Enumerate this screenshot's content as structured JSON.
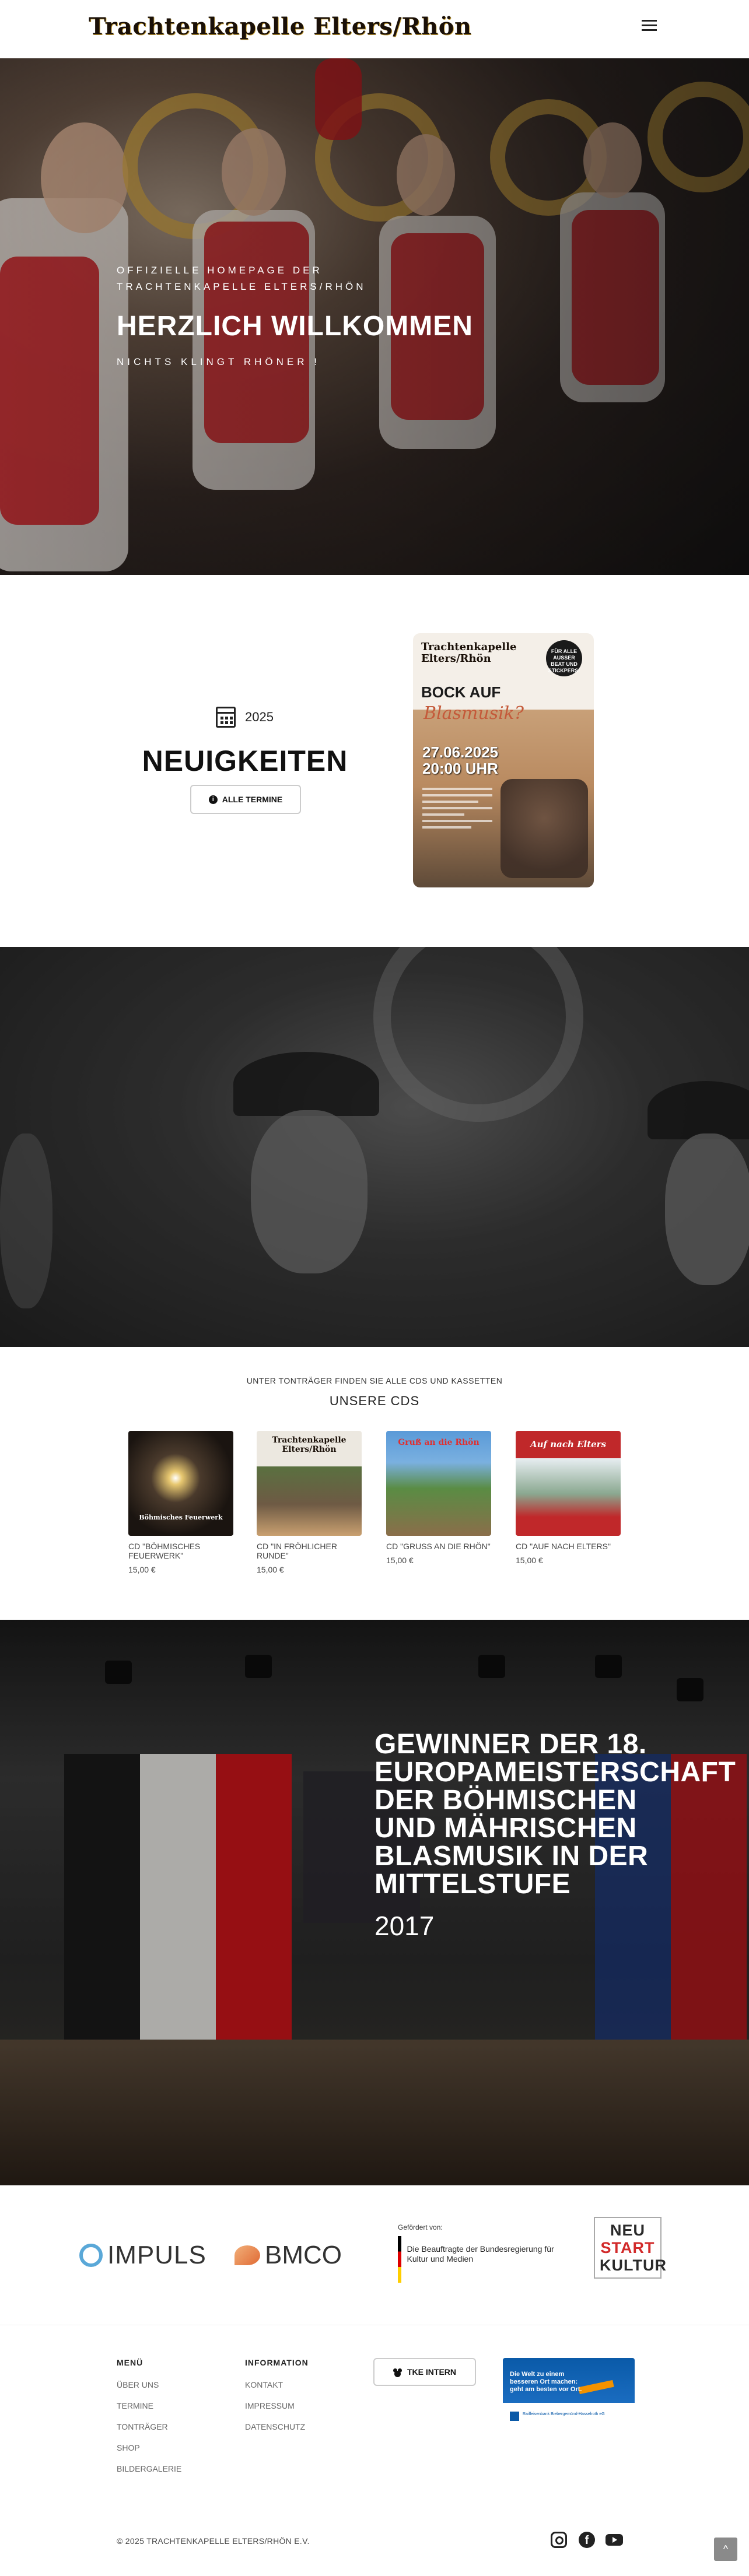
{
  "header": {
    "logo_text": "Trachtenkapelle Elters/Rhön",
    "menu_icon": "hamburger-icon"
  },
  "hero": {
    "kicker_line1": "Offizielle Homepage der",
    "kicker_line2": "Trachtenkapelle Elters/Rhön",
    "title": "HERZLICH WILLKOMMEN",
    "subtitle": "NICHTS KLINGT RHÖNER !"
  },
  "news": {
    "year": "2025",
    "title": "NEUIGKEITEN",
    "button_label": "ALLE TERMINE",
    "poster": {
      "logo_line1": "Trachtenkapelle",
      "logo_line2": "Elters/Rhön",
      "headline": "BOCK AUF",
      "script": "Blasmusik?",
      "date": "27.06.2025",
      "time": "20:00 UHR",
      "badge": "FÜR ALLE AUSSER BEAT UND STICKPERS!"
    }
  },
  "cds": {
    "kicker": "UNTER TONTRÄGER FINDEN SIE ALLE CDS UND KASSETTEN",
    "title": "UNSERE CDS",
    "items": [
      {
        "name": "CD \"Böhmisches Feuerwerk\"",
        "price": "15,00 €",
        "cover_label": "Böhmisches Feuerwerk"
      },
      {
        "name": "CD \"In fröhlicher Runde\"",
        "price": "15,00 €",
        "cover_label": "Trachtenkapelle Elters/Rhön"
      },
      {
        "name": "CD \"Gruß an die Rhön\"",
        "price": "15,00 €",
        "cover_label": "Gruß an die Rhön"
      },
      {
        "name": "CD \"Auf nach Elters\"",
        "price": "15,00 €",
        "cover_label": "Auf nach Elters"
      }
    ]
  },
  "winner": {
    "title": "Gewinner der 18. Europameisterschaft der Böhmischen und Mährischen Blasmusik in der Mittelstufe",
    "year": "2017"
  },
  "sponsors": {
    "impuls": "IMPULS",
    "bmco": "BMCO",
    "bkm_small": "Gefördert von:",
    "bkm_text": "Die Beauftragte der Bundesregierung für Kultur und Medien",
    "neustart_1": "NEU",
    "neustart_2": "START",
    "neustart_3": "KULTUR"
  },
  "footer": {
    "menu_head": "MENÜ",
    "menu_items": [
      "Über uns",
      "Termine",
      "Tonträger",
      "Shop",
      "Bildergalerie"
    ],
    "info_head": "INFORMATION",
    "info_items": [
      "Kontakt",
      "Impressum",
      "Datenschutz"
    ],
    "intern_button": "TKE INTERN",
    "ad_text": "Die Welt zu einem besseren Ort machen: geht am besten vor Ort.",
    "ad_bank": "Raiffeisenbank Biebergemünd-Hasselroth eG",
    "copyright": "© 2025 Trachtenkapelle Elters/Rhön e.V.",
    "to_top": "^"
  }
}
